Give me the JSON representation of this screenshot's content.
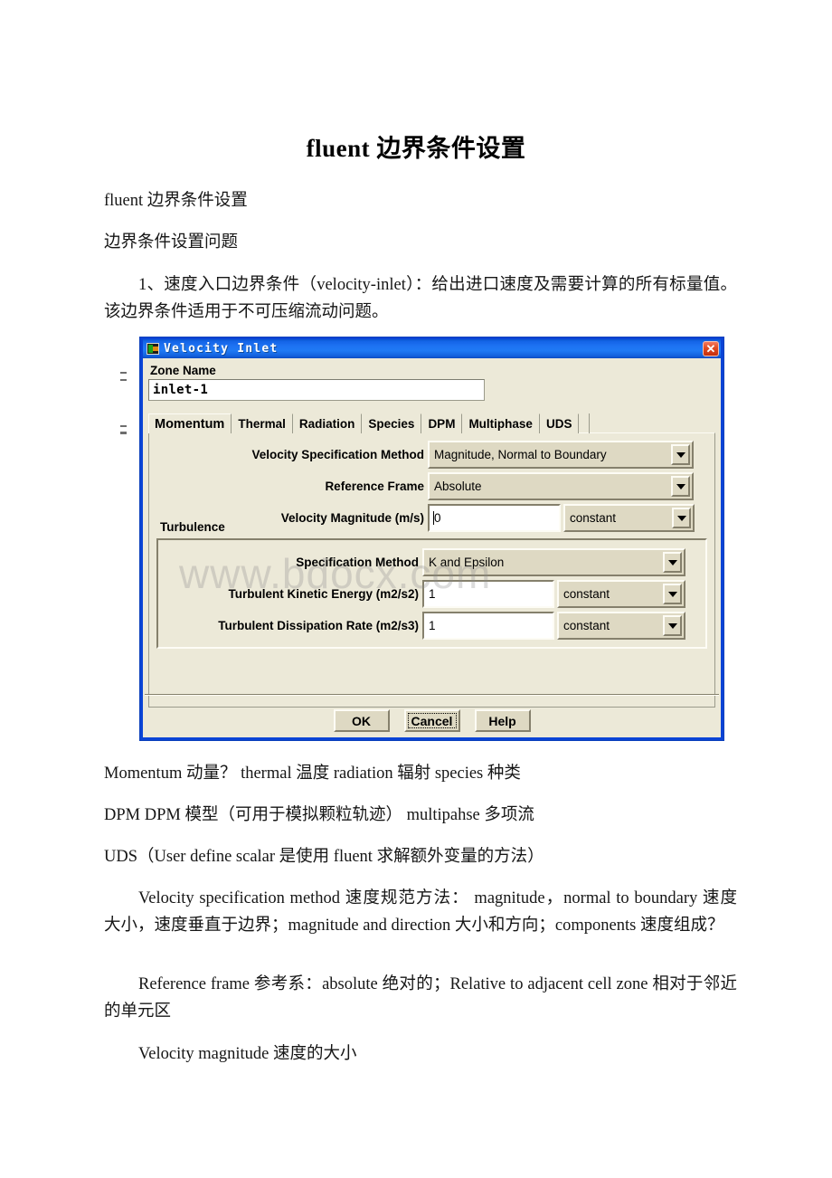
{
  "document": {
    "title": "fluent 边界条件设置",
    "paragraphs": [
      "fluent 边界条件设置",
      "边界条件设置问题",
      "1、速度入口边界条件（velocity-inlet）：给出进口速度及需要计算的所有标量值。该边界条件适用于不可压缩流动问题。",
      "Momentum 动量？ thermal 温度 radiation 辐射 species 种类",
      "DPM DPM 模型（可用于模拟颗粒轨迹） multipahse 多项流",
      "UDS（User define scalar 是使用 fluent 求解额外变量的方法）",
      "Velocity specification method 速度规范方法： magnitude，normal to boundary 速度大小，速度垂直于边界；magnitude and direction 大小和方向；components 速度组成？",
      "Reference frame 参考系：absolute 绝对的；Relative to adjacent cell zone 相对于邻近的单元区",
      "Velocity magnitude 速度的大小"
    ],
    "watermark": "www.bdocx.com"
  },
  "dialog": {
    "title": "Velocity Inlet",
    "icon": "fluent-app-icon",
    "close_label": "✕",
    "zone": {
      "label": "Zone Name",
      "value": "inlet-1"
    },
    "tabs": [
      {
        "label": "Momentum",
        "active": true
      },
      {
        "label": "Thermal",
        "active": false
      },
      {
        "label": "Radiation",
        "active": false
      },
      {
        "label": "Species",
        "active": false
      },
      {
        "label": "DPM",
        "active": false
      },
      {
        "label": "Multiphase",
        "active": false
      },
      {
        "label": "UDS",
        "active": false
      }
    ],
    "momentum": {
      "velocity_spec_method": {
        "label": "Velocity Specification Method",
        "value": "Magnitude, Normal to Boundary"
      },
      "reference_frame": {
        "label": "Reference Frame",
        "value": "Absolute"
      },
      "velocity_magnitude": {
        "label": "Velocity Magnitude (m/s)",
        "value": "0",
        "profile": "constant"
      },
      "turbulence": {
        "group_label": "Turbulence",
        "spec_method": {
          "label": "Specification Method",
          "value": "K and Epsilon"
        },
        "kinetic_energy": {
          "label": "Turbulent Kinetic Energy (m2/s2)",
          "value": "1",
          "profile": "constant"
        },
        "dissipation_rate": {
          "label": "Turbulent Dissipation Rate (m2/s3)",
          "value": "1",
          "profile": "constant"
        }
      }
    },
    "buttons": {
      "ok": "OK",
      "cancel": "Cancel",
      "help": "Help"
    }
  },
  "colors": {
    "titlebar_blue": "#1d72f2",
    "dialog_face": "#ece9d8",
    "widget_face": "#ded9c3",
    "close_red": "#e04a22",
    "border_blue": "#0a44d6"
  }
}
